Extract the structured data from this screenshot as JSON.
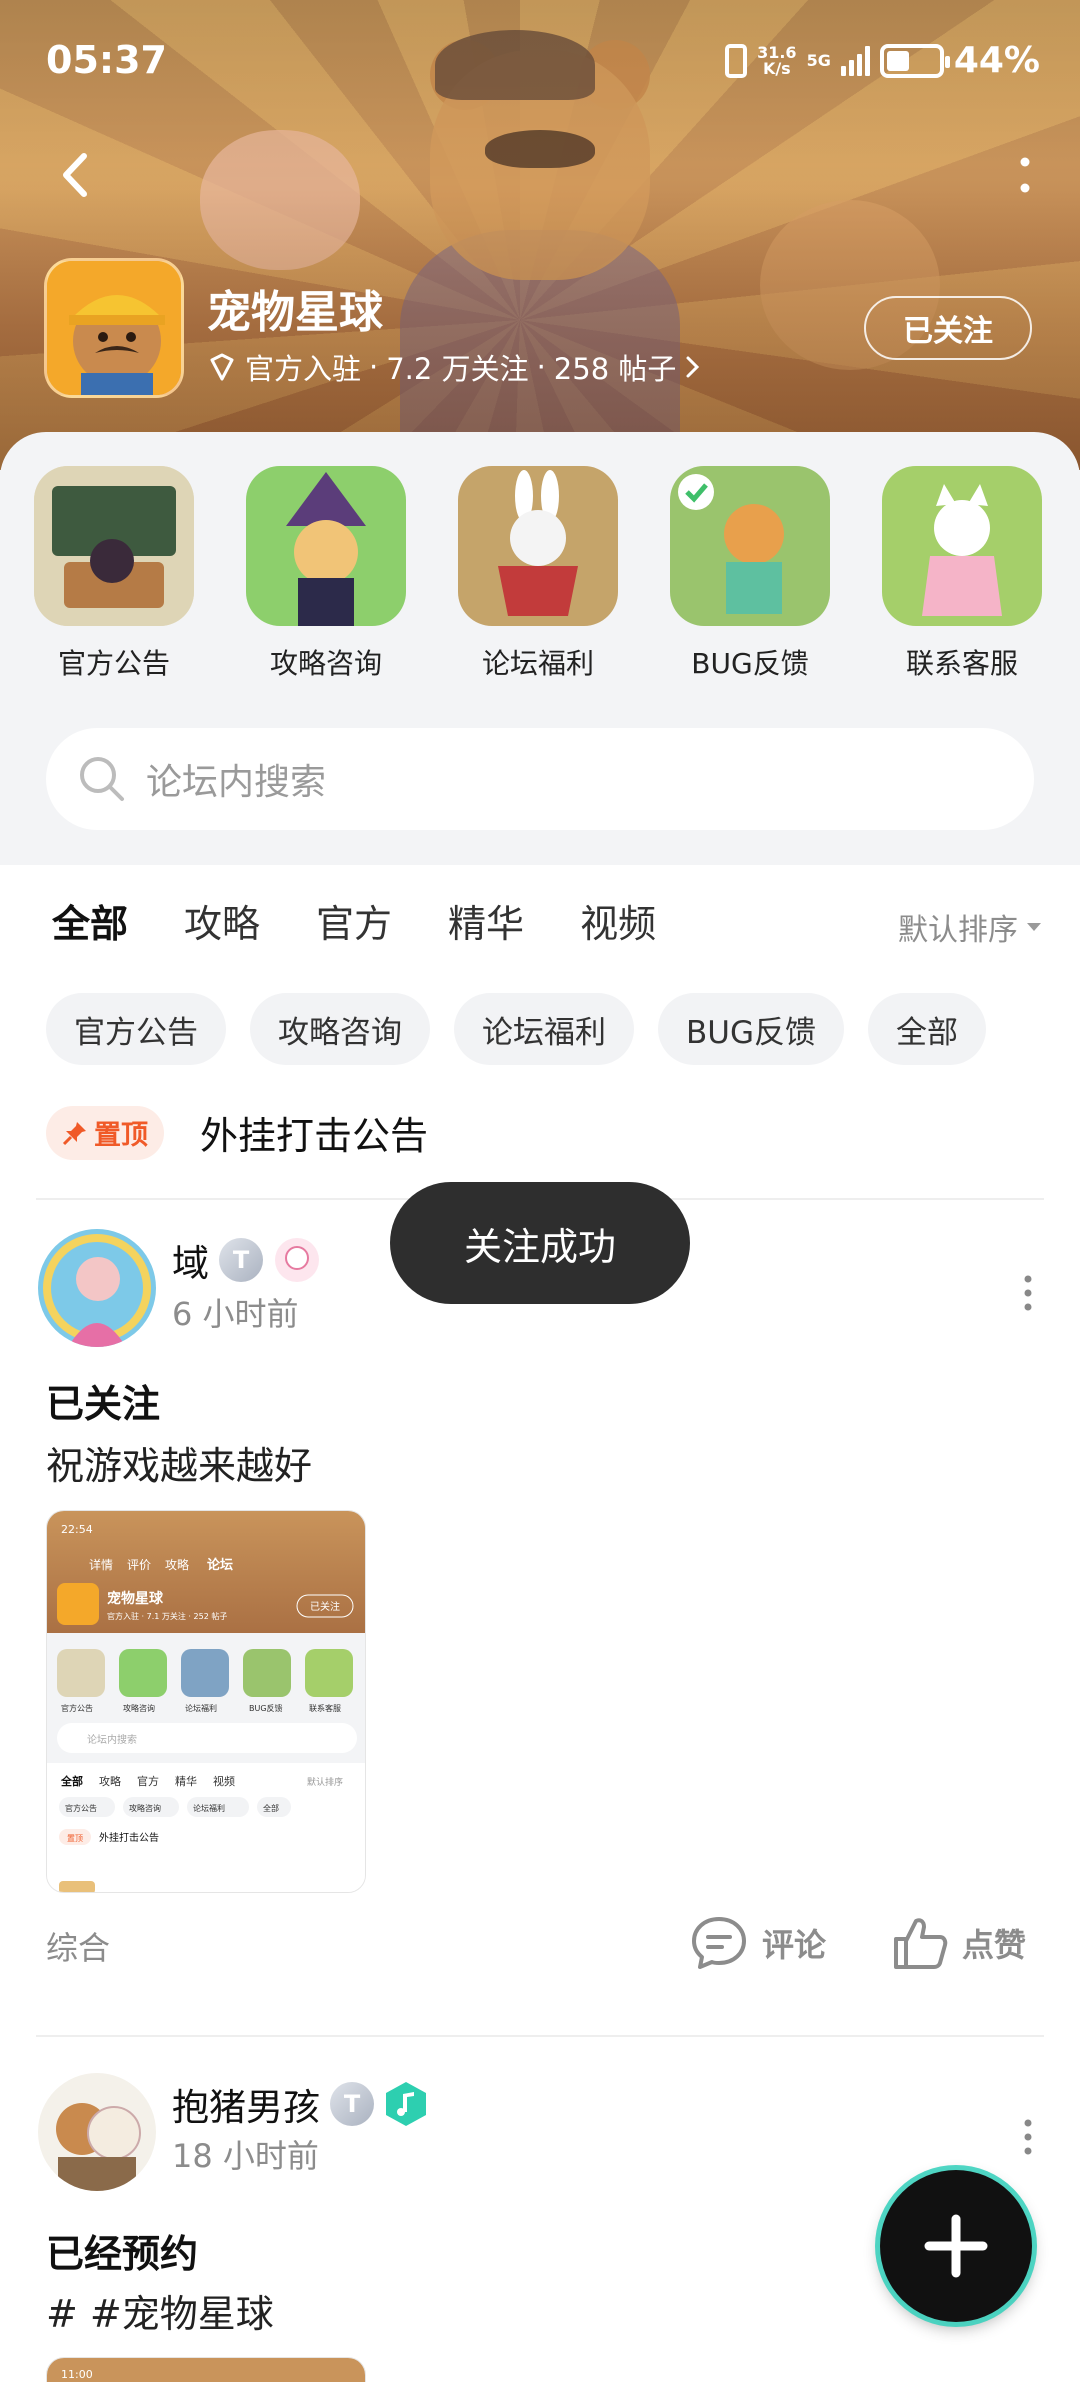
{
  "status_bar": {
    "time": "05:37",
    "net_speed_value": "31.6",
    "net_speed_unit": "K/s",
    "net_type": "5G",
    "battery_pct": "44%",
    "battery_level": 0.44
  },
  "header": {
    "title": "宠物星球",
    "official": "官方入驻",
    "followers": "7.2 万关注",
    "posts": "258 帖子",
    "sep": "·",
    "follow_label": "已关注"
  },
  "quick_links": [
    {
      "label": "官方公告",
      "color": "#e9e1c8"
    },
    {
      "label": "攻略咨询",
      "color": "#8dcf6c"
    },
    {
      "label": "论坛福利",
      "color": "#7fa3c4"
    },
    {
      "label": "BUG反馈",
      "color": "#9ac46d"
    },
    {
      "label": "联系客服",
      "color": "#a5cf6a"
    }
  ],
  "search": {
    "placeholder": "论坛内搜索"
  },
  "tabs": [
    "全部",
    "攻略",
    "官方",
    "精华",
    "视频"
  ],
  "sort_label": "默认排序",
  "chips": [
    "官方公告",
    "攻略咨询",
    "论坛福利",
    "BUG反馈",
    "全部"
  ],
  "pinned": {
    "badge": "置顶",
    "title": "外挂打击公告"
  },
  "toast": "关注成功",
  "posts": [
    {
      "user": "域",
      "level": "T",
      "time": "6 小时前",
      "title": "已关注",
      "body": "祝游戏越来越好",
      "category": "综合",
      "comment_label": "评论",
      "like_label": "点赞"
    },
    {
      "user": "抱猪男孩",
      "level": "T",
      "time": "18 小时前",
      "title": "已经预约",
      "body": "# #宠物星球"
    }
  ],
  "thumb_mini": {
    "time": "22:54",
    "tabs": [
      "详情",
      "评价",
      "攻略",
      "论坛"
    ],
    "title": "宠物星球",
    "meta": "官方入驻 · 7.1 万关注 · 252 帖子",
    "follow": "已关注",
    "quick": [
      "官方公告",
      "攻略咨询",
      "论坛福利",
      "BUG反馈",
      "联系客服"
    ],
    "search": "论坛内搜索",
    "feed_tabs": [
      "全部",
      "攻略",
      "官方",
      "精华",
      "视频"
    ],
    "sort": "默认排序",
    "chips": [
      "官方公告",
      "攻略咨询",
      "论坛福利",
      "全部"
    ],
    "pin_badge": "置顶",
    "pin_title": "外挂打击公告"
  },
  "thumb2_time": "11:00",
  "colors": {
    "accent": "#2dcfb0",
    "pin": "#f05a28",
    "toast_bg": "#2e2e2e"
  }
}
